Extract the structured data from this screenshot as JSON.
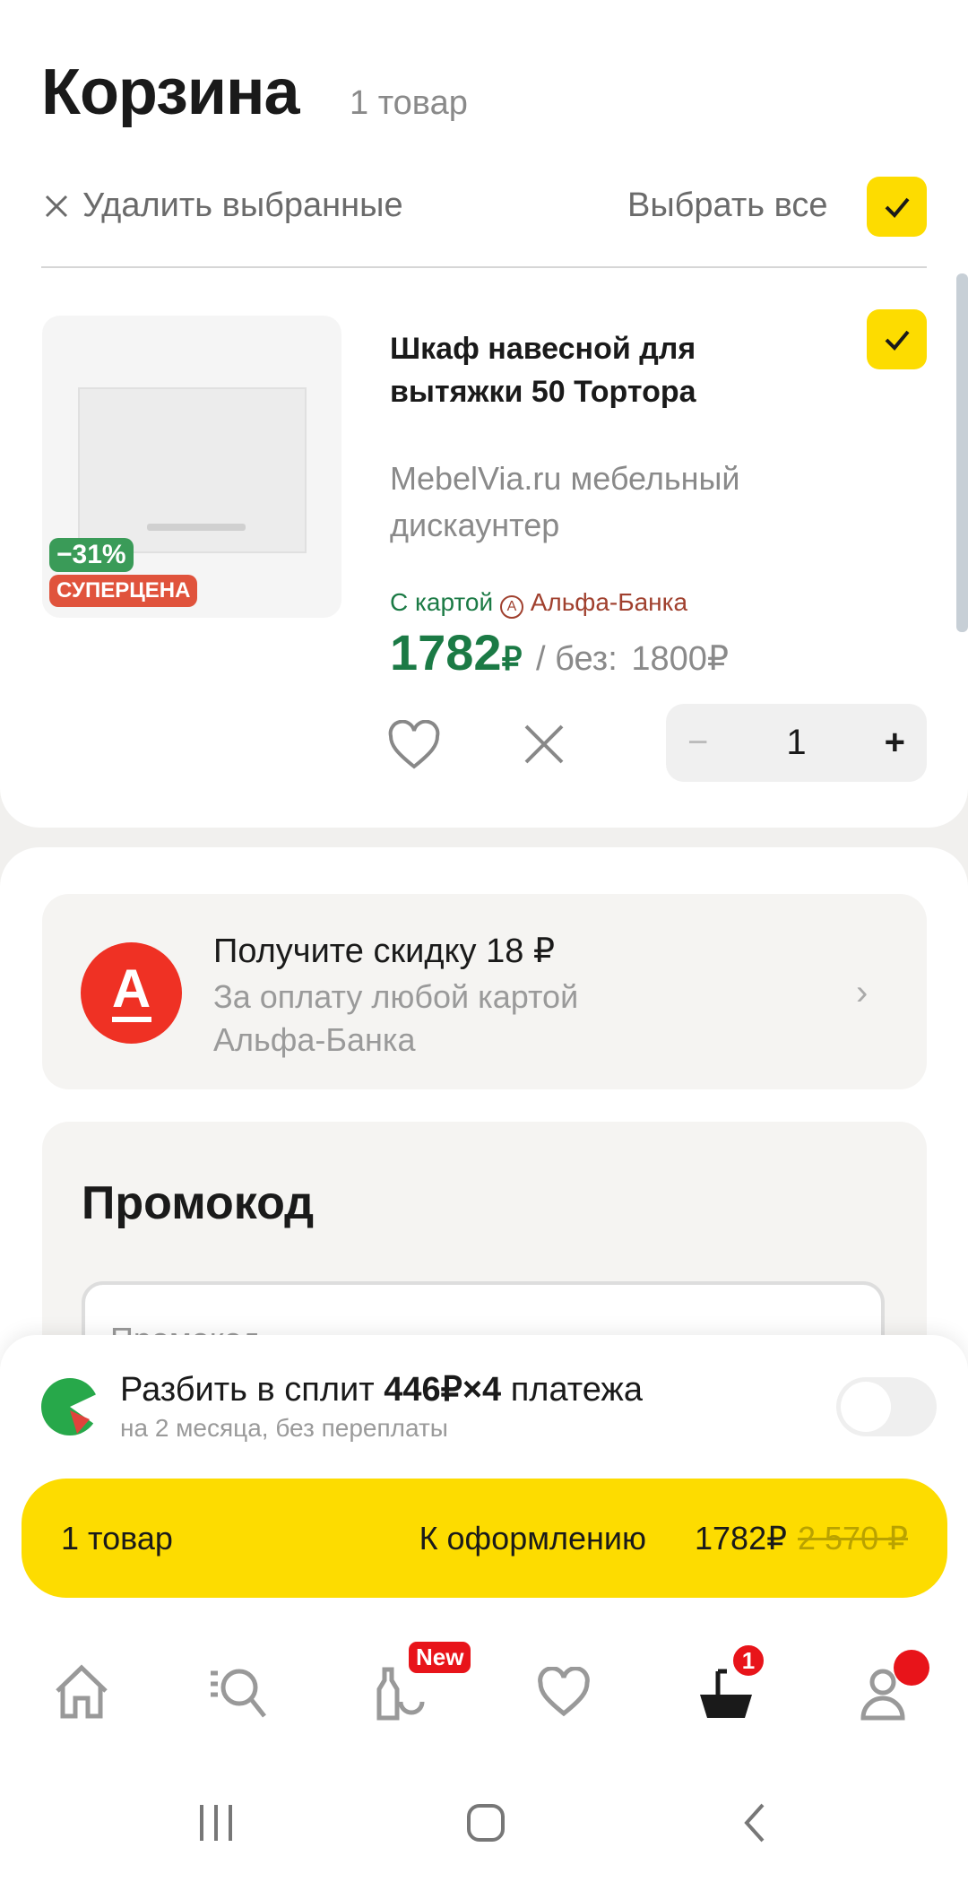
{
  "header": {
    "title": "Корзина",
    "count": "1 товар",
    "delete_selected": "Удалить выбранные",
    "select_all": "Выбрать все"
  },
  "product": {
    "name": "Шкаф навесной для вытяжки 50 Тортора",
    "seller": "MebelVia.ru мебельный дискаунтер",
    "discount_badge": "−31%",
    "super_badge": "СУПЕРЦЕНА",
    "card_label": "С картой",
    "bank": "Альфа-Банка",
    "price": "1782",
    "currency": "₽",
    "without_label": "/ без:",
    "price_without": "1800",
    "quantity": "1",
    "minus": "−",
    "plus": "+"
  },
  "alfa_banner": {
    "logo": "А",
    "title": "Получите скидку 18 ₽",
    "subtitle": "За оплату любой картой Альфа-Банка"
  },
  "promo": {
    "title": "Промокод",
    "placeholder": "Промокод"
  },
  "split": {
    "text": "Разбить в сплит",
    "amount": "446₽×4",
    "tail": "платежа",
    "subtitle": "на 2 месяца, без переплаты",
    "enabled": false
  },
  "checkout": {
    "items": "1 товар",
    "label": "К оформлению",
    "total": "1782₽",
    "old_total": "2 570 ₽"
  },
  "nav": {
    "items": [
      "home-icon",
      "catalog-search-icon",
      "products-icon",
      "favorites-icon",
      "cart-icon",
      "profile-icon"
    ],
    "new_badge": "New",
    "cart_badge": "1"
  },
  "colors": {
    "accent": "#fddc00",
    "price_green": "#1b7a45",
    "alfa_red": "#ef3124"
  }
}
